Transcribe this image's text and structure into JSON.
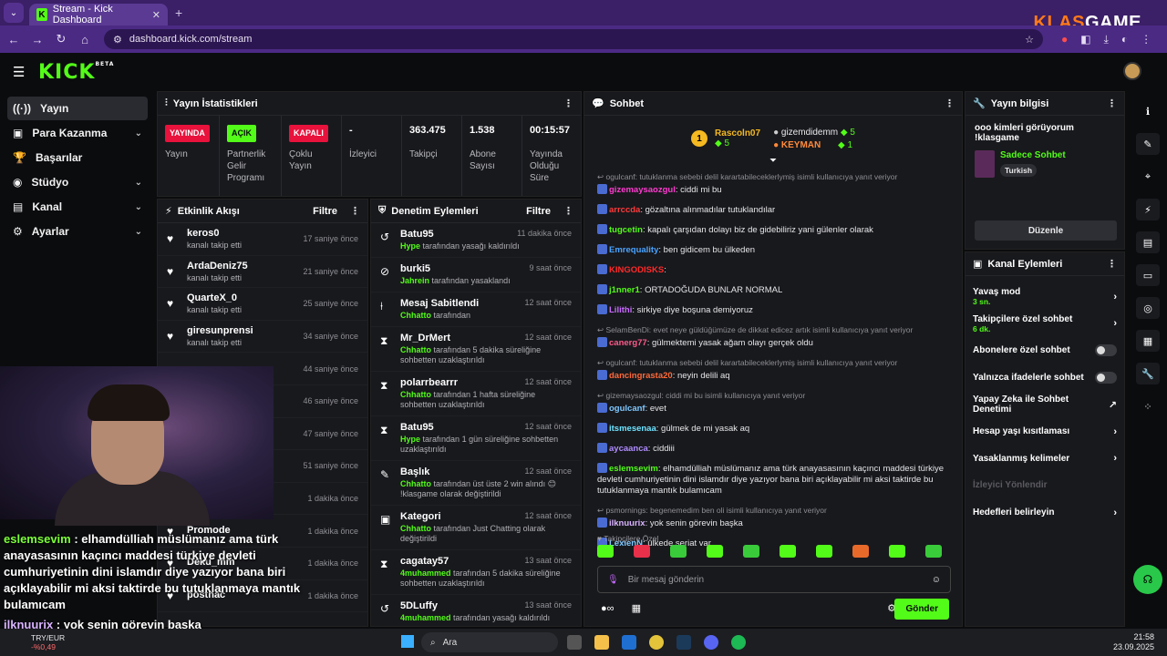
{
  "browser": {
    "tab_title": "Stream - Kick Dashboard",
    "url": "dashboard.kick.com/stream",
    "overlay_brand_a": "KLAS",
    "overlay_brand_b": "GAME"
  },
  "header": {
    "logo": "KICK",
    "beta": "BETA"
  },
  "nav": [
    {
      "label": "Yayın",
      "active": true
    },
    {
      "label": "Para Kazanma"
    },
    {
      "label": "Başarılar"
    },
    {
      "label": "Stüdyo"
    },
    {
      "label": "Kanal"
    },
    {
      "label": "Ayarlar"
    }
  ],
  "stats": {
    "title": "Yayın İstatistikleri",
    "items": [
      {
        "value": "YAYINDA",
        "label": "Yayın"
      },
      {
        "value": "AÇIK",
        "label": "Partnerlik Gelir Programı"
      },
      {
        "value": "KAPALI",
        "label": "Çoklu Yayın"
      },
      {
        "value": "-",
        "label": "İzleyici"
      },
      {
        "value": "363.475",
        "label": "Takipçi"
      },
      {
        "value": "1.538",
        "label": "Abone Sayısı"
      },
      {
        "value": "00:15:57",
        "label": "Yayında Olduğu Süre"
      }
    ]
  },
  "activity": {
    "title": "Etkinlik Akışı",
    "filter": "Filtre",
    "rows": [
      {
        "name": "keros0",
        "action": "kanalı takip etti",
        "time": "17 saniye önce"
      },
      {
        "name": "ArdaDeniz75",
        "action": "kanalı takip etti",
        "time": "21 saniye önce"
      },
      {
        "name": "QuarteX_0",
        "action": "kanalı takip etti",
        "time": "25 saniye önce"
      },
      {
        "name": "giresunprensi",
        "action": "kanalı takip etti",
        "time": "34 saniye önce"
      },
      {
        "name": "",
        "action": "",
        "time": "44 saniye önce"
      },
      {
        "name": "",
        "action": "",
        "time": "46 saniye önce"
      },
      {
        "name": "",
        "action": "",
        "time": "47 saniye önce"
      },
      {
        "name": "",
        "action": "",
        "time": "51 saniye önce"
      },
      {
        "name": "",
        "action": "",
        "time": "1 dakika önce"
      },
      {
        "name": "Promode",
        "action": "",
        "time": "1 dakika önce"
      },
      {
        "name": "Deku_mm",
        "action": "",
        "time": "1 dakika önce"
      },
      {
        "name": "posthac",
        "action": "",
        "time": "1 dakika önce"
      }
    ]
  },
  "moderation": {
    "title": "Denetim Eylemleri",
    "filter": "Filtre",
    "rows": [
      {
        "title": "Batu95",
        "by": "Hype",
        "text": "tarafından yasağı kaldırıldı",
        "time": "11 dakika önce"
      },
      {
        "title": "burki5",
        "by": "Jahrein",
        "text": "tarafından yasaklandı",
        "time": "9 saat önce"
      },
      {
        "title": "Mesaj Sabitlendi",
        "by": "Chhatto",
        "text": "tarafından",
        "time": "12 saat önce"
      },
      {
        "title": "Mr_DrMert",
        "by": "Chhatto",
        "text": "tarafından 5 dakika süreliğine sohbetten uzaklaştırıldı",
        "time": "12 saat önce"
      },
      {
        "title": "polarrbearrr",
        "by": "Chhatto",
        "text": "tarafından 1 hafta süreliğine sohbetten uzaklaştırıldı",
        "time": "12 saat önce"
      },
      {
        "title": "Batu95",
        "by": "Hype",
        "text": "tarafından 1 gün süreliğine sohbetten uzaklaştırıldı",
        "time": "12 saat önce"
      },
      {
        "title": "Başlık",
        "by": "Chhatto",
        "text": "tarafından üst üste 2 win alındı 😊 !klasgame olarak değiştirildi",
        "time": "12 saat önce"
      },
      {
        "title": "Kategori",
        "by": "Chhatto",
        "text": "tarafından Just Chatting olarak değiştirildi",
        "time": "12 saat önce"
      },
      {
        "title": "cagatay57",
        "by": "4muhammed",
        "text": "tarafından 5 dakika süreliğine sohbetten uzaklaştırıldı",
        "time": "13 saat önce"
      },
      {
        "title": "5DLuffy",
        "by": "4muhammed",
        "text": "tarafından yasağı kaldırıldı",
        "time": "13 saat önce"
      },
      {
        "title": "5DLuffy",
        "by": "",
        "text": "",
        "time": ""
      }
    ]
  },
  "chat": {
    "title": "Sohbet",
    "leader1": {
      "name": "Rascoln07",
      "count": "5"
    },
    "leader2": {
      "name": "gizemdidemm",
      "count": "5"
    },
    "leader3": {
      "name": "KEYMAN",
      "count": "1"
    },
    "messages": [
      {
        "reply": "ogulcanf: tutuklanma sebebi delil karartabileceklerlymiş isimli kullanıcıya yanıt veriyor",
        "user": "gizemaysaozgul",
        "color": "#ff3bd0",
        "text": "ciddi mi bu"
      },
      {
        "reply": "",
        "user": "arrccda",
        "color": "#ff3b3b",
        "text": "gözaltına alınmadılar tutuklandılar"
      },
      {
        "reply": "",
        "user": "tugcetin",
        "color": "#53fc18",
        "text": "kapalı çarşıdan dolayı biz de gidebiliriz yani gülenler olarak"
      },
      {
        "reply": "",
        "user": "Emrequality",
        "color": "#4aa3ff",
        "text": "ben gidicem bu ülkeden"
      },
      {
        "reply": "",
        "user": "KINGODISKS",
        "color": "#ff2a2a",
        "text": ""
      },
      {
        "reply": "",
        "user": "j1nner1",
        "color": "#53fc18",
        "text": "ORTADOĞUDA BUNLAR NORMAL"
      },
      {
        "reply": "",
        "user": "Lilithi",
        "color": "#c86bff",
        "text": "sirkiye diye boşuna demiyoruz"
      },
      {
        "reply": "SelamBenDi: evet neye güldüğümüze de dikkat edicez artık isimli kullanıcıya yanıt veriyor",
        "user": "canerg77",
        "color": "#ff5a8a",
        "text": "gülmektemi yasak ağam olayı gerçek oldu"
      },
      {
        "reply": "ogulcanf: tutuklanma sebebi delil karartabileceklerlymiş isimli kullanıcıya yanıt veriyor",
        "user": "dancingrasta20",
        "color": "#ff6a3a",
        "text": "neyin delili aq"
      },
      {
        "reply": "gizemaysaozgul: ciddi mi bu isimli kullanıcıya yanıt veriyor",
        "user": "ogulcanf",
        "color": "#7fc8ff",
        "text": "evet"
      },
      {
        "reply": "",
        "user": "itsmesenaa",
        "color": "#6fe3ff",
        "text": "gülmek de mi yasak aq"
      },
      {
        "reply": "",
        "user": "aycaanca",
        "color": "#b08cff",
        "text": "ciddiii"
      },
      {
        "reply": "",
        "user": "eslemsevim",
        "color": "#53fc18",
        "text": "elhamdülliah müslümanız ama türk anayasasının kaçıncı maddesi türkiye devleti cumhuriyetinin dini islamdır diye yazıyor bana biri açıklayabilir mi aksi taktirde bu tutuklanmaya mantık bulamıcam"
      },
      {
        "reply": "psmornings: begenemedim ben oli isimli kullanıcıya yanıt veriyor",
        "user": "ilknuurix",
        "color": "#d9b3ff",
        "text": "yok senin görevin başka"
      },
      {
        "reply": "",
        "user": "LexienN",
        "color": "#7fc8ff",
        "text": "ulkede seriat var"
      }
    ],
    "followers_only": "Takipçilere Özel",
    "placeholder": "Bir mesaj gönderin",
    "send": "Gönder"
  },
  "stream_info": {
    "title": "Yayın bilgisi",
    "stream_title": "ooo kimleri görüyorum !klasgame",
    "category": "Sadece Sohbet",
    "tag": "Turkish",
    "edit": "Düzenle"
  },
  "channel_actions": {
    "title": "Kanal Eylemleri",
    "rows": [
      {
        "label": "Yavaş mod",
        "sub": "3 sn.",
        "kind": "chevron"
      },
      {
        "label": "Takipçilere özel sohbet",
        "sub": "6 dk.",
        "kind": "chevron"
      },
      {
        "label": "Abonelere özel sohbet",
        "sub": "",
        "kind": "toggle"
      },
      {
        "label": "Yalnızca ifadelerle sohbet",
        "sub": "",
        "kind": "toggle"
      },
      {
        "label": "Yapay Zeka ile Sohbet Denetimi",
        "sub": "",
        "kind": "external"
      },
      {
        "label": "Hesap yaşı kısıtlaması",
        "sub": "",
        "kind": "chevron"
      },
      {
        "label": "Yasaklanmış kelimeler",
        "sub": "",
        "kind": "chevron"
      },
      {
        "label": "İzleyici Yönlendir",
        "sub": "",
        "kind": "disabled"
      },
      {
        "label": "Hedefleri belirleyin",
        "sub": "",
        "kind": "chevron"
      }
    ]
  },
  "overlay_chat": {
    "line0": "eslemsevim",
    "line0_text": " : elhamdülliah müslümanız ama türk",
    "line1": "anayasasının kaçıncı maddesi türkiye devleti",
    "line2": "cumhuriyetinin dini islamdır diye yazıyor bana biri",
    "line3": "açıklayabilir mi aksi taktirde bu tutuklanmaya mantık",
    "line4": "bulamıcam",
    "line5": "ilknuurix",
    "line5_text": " : yok senin görevin başka"
  },
  "taskbar": {
    "search": "Ara",
    "ticker": "TRY/EUR",
    "ticker_change": "-%0,49",
    "time": "21:58",
    "date": "23.09.2025"
  }
}
